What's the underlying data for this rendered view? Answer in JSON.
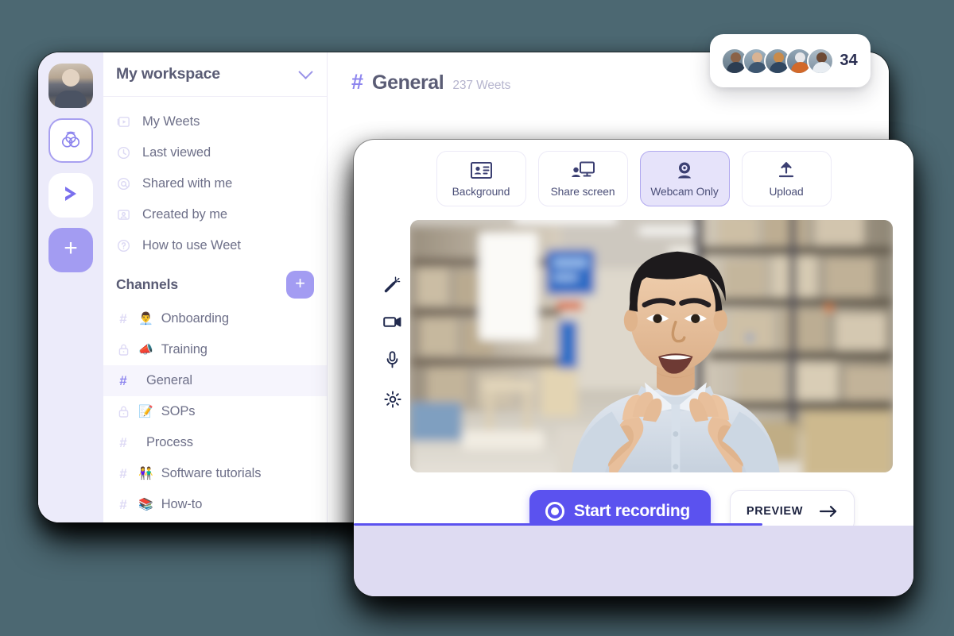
{
  "theme": {
    "page_background": "#4c6872",
    "accent": "#5b52ef",
    "accent_soft": "#a39cf2",
    "rail_background": "#ecebfa",
    "selected_mode_fill": "#e6e3fa",
    "selected_mode_border": "#b1a9ef",
    "footer_fill": "#dedbf2",
    "active_channel_fill": "#f6f5fd",
    "text_primary": "#5a5c75",
    "text_secondary": "#6e7089",
    "text_muted": "#b6b5ce"
  },
  "rail": {
    "items": [
      {
        "name": "user-avatar",
        "icon": "avatar-icon",
        "label": ""
      },
      {
        "name": "weet-app",
        "icon": "weet-logo-icon",
        "label": "",
        "selected": true
      },
      {
        "name": "send-app",
        "icon": "send-arrow-icon",
        "label": ""
      },
      {
        "name": "add-workspace",
        "icon": "plus-icon",
        "label": "+"
      }
    ]
  },
  "sidebar": {
    "workspace_name": "My workspace",
    "workspace_chevron_icon": "chevron-down-icon",
    "nav_items": [
      {
        "label": "My Weets",
        "icon": "video-play-icon"
      },
      {
        "label": "Last viewed",
        "icon": "clock-icon"
      },
      {
        "label": "Shared with me",
        "icon": "at-sign-icon"
      },
      {
        "label": "Created by me",
        "icon": "contact-card-icon"
      },
      {
        "label": "How to use Weet",
        "icon": "question-circle-icon"
      }
    ],
    "channels_title": "Channels",
    "add_channel_label": "+",
    "channels": [
      {
        "label": "Onboarding",
        "emoji": "👨‍💼",
        "symbol": "hash",
        "active": false
      },
      {
        "label": "Training",
        "emoji": "📣",
        "symbol": "lock",
        "active": false
      },
      {
        "label": "General",
        "emoji": "",
        "symbol": "hash",
        "active": true
      },
      {
        "label": "SOPs",
        "emoji": "📝",
        "symbol": "lock",
        "active": false
      },
      {
        "label": "Process",
        "emoji": "",
        "symbol": "hash",
        "active": false
      },
      {
        "label": "Software tutorials",
        "emoji": "👫",
        "symbol": "hash",
        "active": false
      },
      {
        "label": "How-to",
        "emoji": "📚",
        "symbol": "hash",
        "active": false
      }
    ]
  },
  "channel_header": {
    "hash": "#",
    "title": "General",
    "count_text": "237 Weets"
  },
  "members": {
    "count": "34",
    "avatar_count": 5
  },
  "recorder": {
    "modes": [
      {
        "label": "Background",
        "icon": "id-card-icon",
        "selected": false
      },
      {
        "label": "Share screen",
        "icon": "screen-share-icon",
        "selected": false
      },
      {
        "label": "Webcam Only",
        "icon": "webcam-icon",
        "selected": true
      },
      {
        "label": "Upload",
        "icon": "upload-icon",
        "selected": false
      }
    ],
    "tools": [
      {
        "name": "magic-wand-icon",
        "title": "Effects"
      },
      {
        "name": "video-camera-icon",
        "title": "Camera"
      },
      {
        "name": "microphone-icon",
        "title": "Microphone"
      },
      {
        "name": "gear-icon",
        "title": "Settings"
      }
    ],
    "preview_alt": "Webcam preview of a man speaking in a warehouse aisle",
    "start_label": "Start recording",
    "start_icon": "record-circle-icon",
    "preview_label": "PREVIEW",
    "preview_icon": "arrow-right-icon",
    "progress_percent": 73
  }
}
